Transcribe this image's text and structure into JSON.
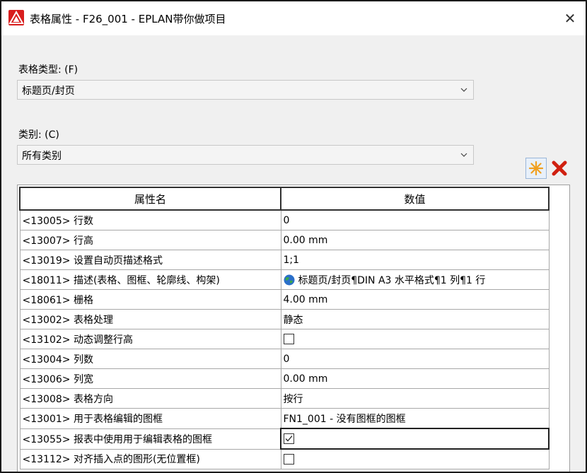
{
  "window": {
    "title": "表格属性 - F26_001 - EPLAN带你做项目",
    "close_symbol": "✕",
    "accent_color": "#d81e1e"
  },
  "form_type": {
    "label": "表格类型: (F)",
    "value": "标题页/封页"
  },
  "category": {
    "label": "类别: (C)",
    "value": "所有类别"
  },
  "toolbar": {
    "new_icon": "asterisk-icon",
    "delete_icon": "red-x-icon"
  },
  "grid": {
    "headers": [
      "属性名",
      "数值"
    ],
    "rows": [
      {
        "name": "<13005> 行数",
        "value": "0",
        "kind": "text"
      },
      {
        "name": "<13007> 行高",
        "value": "0.00 mm",
        "kind": "text"
      },
      {
        "name": "<13019> 设置自动页描述格式",
        "value": "1;1",
        "kind": "text"
      },
      {
        "name": "<18011> 描述(表格、图框、轮廓线、构架)",
        "value": "标题页/封页¶DIN A3 水平格式¶1 列¶1 行",
        "kind": "globe"
      },
      {
        "name": "<18061> 栅格",
        "value": "4.00 mm",
        "kind": "text"
      },
      {
        "name": "<13002> 表格处理",
        "value": "静态",
        "kind": "text"
      },
      {
        "name": "<13102> 动态调整行高",
        "checked": false,
        "kind": "checkbox"
      },
      {
        "name": "<13004> 列数",
        "value": "0",
        "kind": "text"
      },
      {
        "name": "<13006> 列宽",
        "value": "0.00 mm",
        "kind": "text"
      },
      {
        "name": "<13008> 表格方向",
        "value": "按行",
        "kind": "text"
      },
      {
        "name": "<13001> 用于表格编辑的图框",
        "value": "FN1_001 - 没有图框的图框",
        "kind": "text"
      },
      {
        "name": "<13055> 报表中使用用于编辑表格的图框",
        "checked": true,
        "kind": "checkbox",
        "selected": true
      },
      {
        "name": "<13112> 对齐插入点的图形(无位置框)",
        "checked": false,
        "kind": "checkbox"
      }
    ]
  }
}
